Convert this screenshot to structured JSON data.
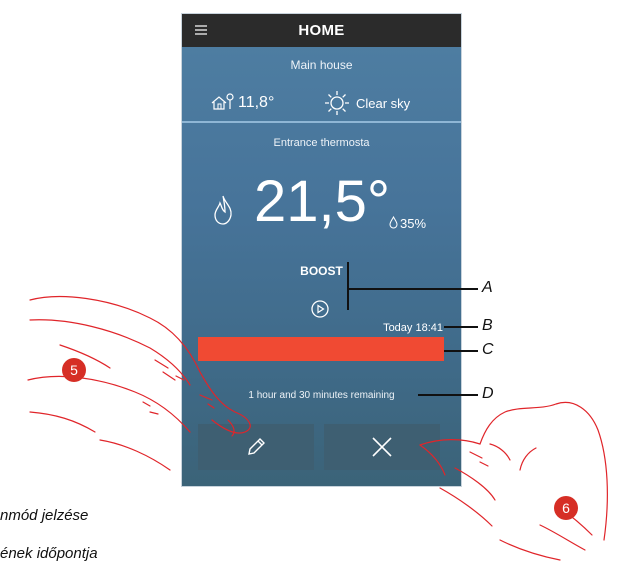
{
  "app_bar": {
    "title": "HOME",
    "menu_icon": "hamburger-menu-icon"
  },
  "location": {
    "name": "Main house"
  },
  "weather": {
    "outdoor_temp": "11,8°",
    "condition": "Clear sky",
    "house_icon": "house-sensor-icon",
    "sun_icon": "sun-icon"
  },
  "zone": {
    "name": "Entrance thermosta",
    "temperature": "21,5°",
    "humidity": "35%",
    "mode_icon": "flame-icon",
    "humidity_icon": "drop-icon"
  },
  "boost": {
    "label": "BOOST",
    "play_icon": "play-icon",
    "end_time": "Today 18:41",
    "progress_percent": 100,
    "bar_color": "#f04a33",
    "remaining": "1 hour and 30 minutes remaining"
  },
  "buttons": {
    "edit_icon": "pencil-icon",
    "cancel_icon": "close-icon"
  },
  "callouts": {
    "a": "A",
    "b": "B",
    "c": "C",
    "d": "D"
  },
  "markers": {
    "five": "5",
    "six": "6"
  },
  "captions": {
    "line1": "nmód jelzése",
    "line2": "ének időpontja"
  }
}
